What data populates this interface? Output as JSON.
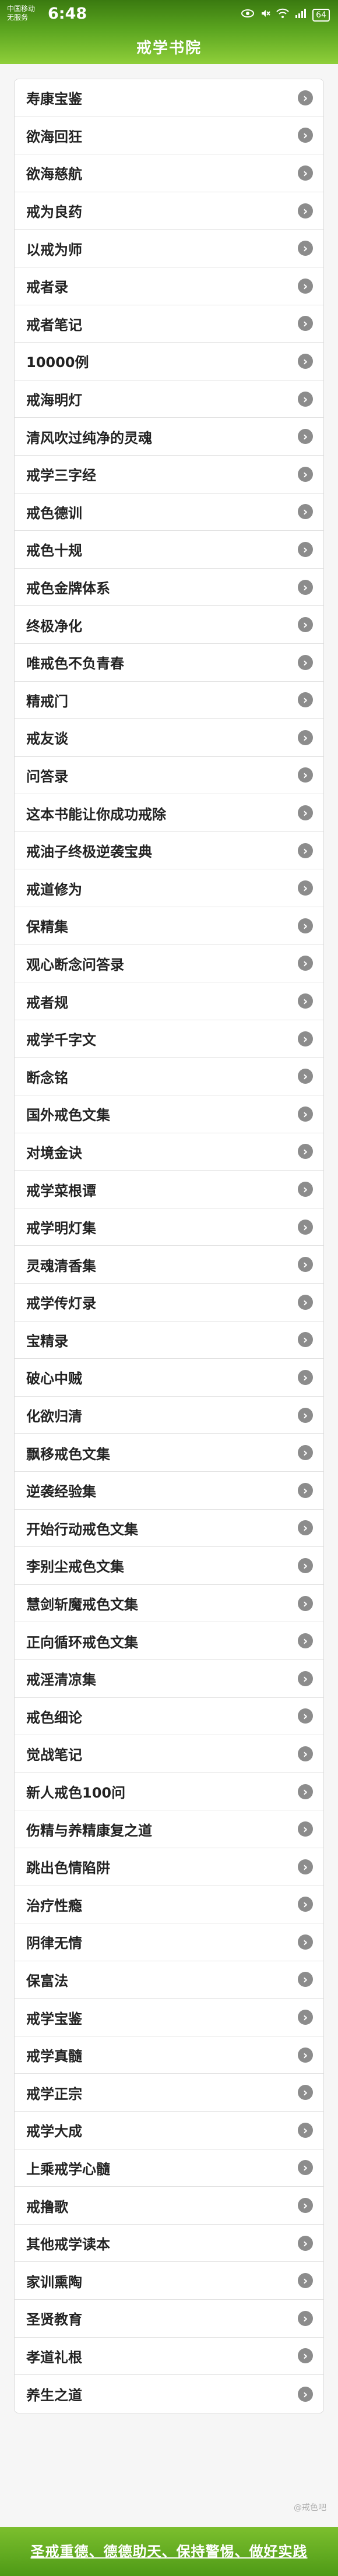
{
  "status_bar": {
    "carrier_line1": "中国移动",
    "carrier_line2": "无服务",
    "time": "6:48",
    "battery": "64",
    "icons": [
      "eye-icon",
      "mute-icon",
      "wifi-icon",
      "signal-icon",
      "battery-icon"
    ]
  },
  "header": {
    "title": "戒学书院"
  },
  "items": [
    "寿康宝鉴",
    "欲海回狂",
    "欲海慈航",
    "戒为良药",
    "以戒为师",
    "戒者录",
    "戒者笔记",
    "10000例",
    "戒海明灯",
    "清风吹过纯净的灵魂",
    "戒学三字经",
    "戒色德训",
    "戒色十规",
    "戒色金牌体系",
    "终极净化",
    "唯戒色不负青春",
    "精戒门",
    "戒友谈",
    "问答录",
    "这本书能让你成功戒除",
    "戒油子终极逆袭宝典",
    "戒道修为",
    "保精集",
    "观心断念问答录",
    "戒者规",
    "戒学千字文",
    "断念铭",
    "国外戒色文集",
    "对境金诀",
    "戒学菜根谭",
    "戒学明灯集",
    "灵魂清香集",
    "戒学传灯录",
    "宝精录",
    "破心中贼",
    "化欲归清",
    "飘移戒色文集",
    "逆袭经验集",
    "开始行动戒色文集",
    "李别尘戒色文集",
    "慧剑斩魔戒色文集",
    "正向循环戒色文集",
    "戒淫清凉集",
    "戒色细论",
    "觉战笔记",
    "新人戒色100问",
    "伤精与养精康复之道",
    "跳出色情陷阱",
    "治疗性瘾",
    "阴律无情",
    "保富法",
    "戒学宝鉴",
    "戒学真髓",
    "戒学正宗",
    "戒学大成",
    "上乘戒学心髓",
    "戒撸歌",
    "其他戒学读本",
    "家训熏陶",
    "圣贤教育",
    "孝道礼根",
    "养生之道"
  ],
  "footer": {
    "text": "圣戒重德、德德助天、保持警惕、做好实践"
  },
  "watermark": "@戒色吧"
}
